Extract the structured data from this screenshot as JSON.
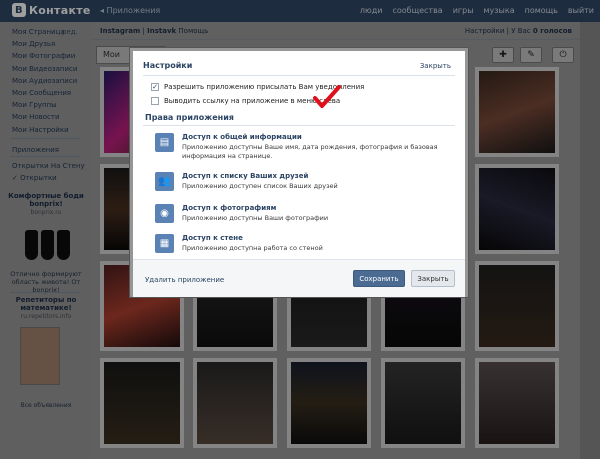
{
  "topbar": {
    "logo_letter": "В",
    "logo_text": "Контакте",
    "back_label": "◂ Приложения",
    "nav": [
      "люди",
      "сообщества",
      "игры",
      "музыка",
      "помощь",
      "выйти"
    ]
  },
  "sidebar": {
    "edit_label": "ред.",
    "items": [
      "Моя Страница",
      "Мои Друзья",
      "Мои Фотографии",
      "Мои Видеозаписи",
      "Мои Аудиозаписи",
      "Мои Сообщения",
      "Мои Группы",
      "Мои Новости",
      "Мои Настройки"
    ],
    "apps_label": "Приложения",
    "extra": [
      "Открытки На Стену",
      "✓ Открытки"
    ],
    "ad1": {
      "title": "Комфортные боди bonprix!",
      "domain": "bonprix.ru",
      "text": "Отлично формируют область живота! От bonprix!"
    },
    "ad2": {
      "title": "Репетиторы по математике!",
      "domain": "ru.repetitors.info"
    },
    "all_ads": "Все объявления"
  },
  "app": {
    "crumb_app": "Instagram",
    "crumb_sep": "|",
    "crumb_page": "Instavk",
    "crumb_help": "Помощь",
    "settings_link": "Настройки",
    "votes_prefix": "| У Вас",
    "votes_value": "0 голосов",
    "tab_label": "Мои"
  },
  "modal": {
    "title": "Настройки",
    "close_link": "Закрыть",
    "options": [
      {
        "label": "Разрешить приложению присылать Вам уведомления",
        "checked": true
      },
      {
        "label": "Выводить ссылку на приложение в меню слева",
        "checked": false
      }
    ],
    "permissions_title": "Права приложения",
    "permissions": [
      {
        "icon": "profile-card-icon",
        "glyph": "▤",
        "title": "Доступ к общей информации",
        "desc": "Приложению доступны Ваше имя, дата рождения, фотография и базовая информация на странице."
      },
      {
        "icon": "friends-icon",
        "glyph": "👥",
        "title": "Доступ к списку Ваших друзей",
        "desc": "Приложению доступен список Ваших друзей"
      },
      {
        "icon": "camera-icon",
        "glyph": "◉",
        "title": "Доступ к фотографиям",
        "desc": "Приложению доступны Ваши фотографии"
      },
      {
        "icon": "wall-icon",
        "glyph": "▦",
        "title": "Доступ к стене",
        "desc": "Приложению доступна работа со стеной"
      }
    ],
    "delete_link": "Удалить приложение",
    "save_button": "Сохранить",
    "close_button": "Закрыть"
  },
  "colors": {
    "accent": "#2b4464",
    "topbar": "#2f4766",
    "save_button": "#4b6b92",
    "red_check": "#e0101b"
  }
}
